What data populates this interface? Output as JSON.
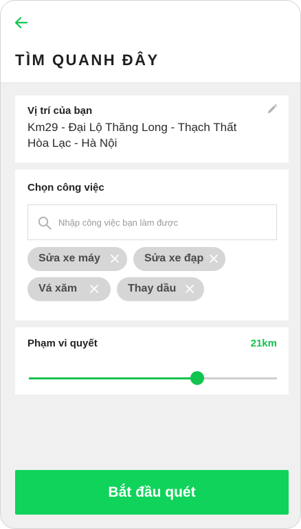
{
  "header": {
    "back_icon": "arrow-left-icon",
    "title": "TÌM QUANH ĐÂY"
  },
  "location": {
    "label": "Vị trí của bạn",
    "line1": "Km29 - Đại Lộ Thăng Long - Thạch Thất",
    "line2": "Hòa Lạc - Hà Nội",
    "edit_icon": "pencil-icon"
  },
  "jobs": {
    "label": "Chọn công việc",
    "search_placeholder": "Nhập công việc bạn làm được",
    "search_value": "",
    "search_icon": "search-icon",
    "chips": [
      {
        "label": "Sửa xe máy",
        "close_icon": "close-icon"
      },
      {
        "label": "Sửa xe đạp",
        "close_icon": "close-icon"
      },
      {
        "label": "Vá xăm",
        "close_icon": "close-icon"
      },
      {
        "label": "Thay dầu",
        "close_icon": "close-icon"
      }
    ]
  },
  "range": {
    "label": "Phạm vi quyết",
    "value_text": "21km",
    "slider_fraction": 0.68
  },
  "action": {
    "start_label": "Bắt đầu quét"
  },
  "colors": {
    "accent": "#10c44f",
    "button": "#0fd35b",
    "chip_bg": "#d6d6d6",
    "screen_bg": "#f0f0f0"
  }
}
